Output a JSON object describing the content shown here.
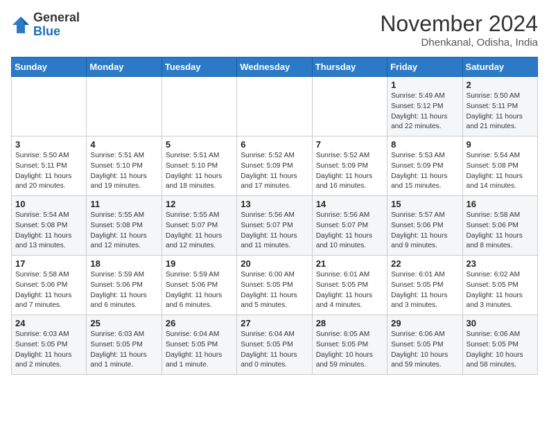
{
  "logo": {
    "general": "General",
    "blue": "Blue"
  },
  "header": {
    "month": "November 2024",
    "location": "Dhenkanal, Odisha, India"
  },
  "weekdays": [
    "Sunday",
    "Monday",
    "Tuesday",
    "Wednesday",
    "Thursday",
    "Friday",
    "Saturday"
  ],
  "weeks": [
    [
      {
        "day": "",
        "info": ""
      },
      {
        "day": "",
        "info": ""
      },
      {
        "day": "",
        "info": ""
      },
      {
        "day": "",
        "info": ""
      },
      {
        "day": "",
        "info": ""
      },
      {
        "day": "1",
        "info": "Sunrise: 5:49 AM\nSunset: 5:12 PM\nDaylight: 11 hours\nand 22 minutes."
      },
      {
        "day": "2",
        "info": "Sunrise: 5:50 AM\nSunset: 5:11 PM\nDaylight: 11 hours\nand 21 minutes."
      }
    ],
    [
      {
        "day": "3",
        "info": "Sunrise: 5:50 AM\nSunset: 5:11 PM\nDaylight: 11 hours\nand 20 minutes."
      },
      {
        "day": "4",
        "info": "Sunrise: 5:51 AM\nSunset: 5:10 PM\nDaylight: 11 hours\nand 19 minutes."
      },
      {
        "day": "5",
        "info": "Sunrise: 5:51 AM\nSunset: 5:10 PM\nDaylight: 11 hours\nand 18 minutes."
      },
      {
        "day": "6",
        "info": "Sunrise: 5:52 AM\nSunset: 5:09 PM\nDaylight: 11 hours\nand 17 minutes."
      },
      {
        "day": "7",
        "info": "Sunrise: 5:52 AM\nSunset: 5:09 PM\nDaylight: 11 hours\nand 16 minutes."
      },
      {
        "day": "8",
        "info": "Sunrise: 5:53 AM\nSunset: 5:09 PM\nDaylight: 11 hours\nand 15 minutes."
      },
      {
        "day": "9",
        "info": "Sunrise: 5:54 AM\nSunset: 5:08 PM\nDaylight: 11 hours\nand 14 minutes."
      }
    ],
    [
      {
        "day": "10",
        "info": "Sunrise: 5:54 AM\nSunset: 5:08 PM\nDaylight: 11 hours\nand 13 minutes."
      },
      {
        "day": "11",
        "info": "Sunrise: 5:55 AM\nSunset: 5:08 PM\nDaylight: 11 hours\nand 12 minutes."
      },
      {
        "day": "12",
        "info": "Sunrise: 5:55 AM\nSunset: 5:07 PM\nDaylight: 11 hours\nand 12 minutes."
      },
      {
        "day": "13",
        "info": "Sunrise: 5:56 AM\nSunset: 5:07 PM\nDaylight: 11 hours\nand 11 minutes."
      },
      {
        "day": "14",
        "info": "Sunrise: 5:56 AM\nSunset: 5:07 PM\nDaylight: 11 hours\nand 10 minutes."
      },
      {
        "day": "15",
        "info": "Sunrise: 5:57 AM\nSunset: 5:06 PM\nDaylight: 11 hours\nand 9 minutes."
      },
      {
        "day": "16",
        "info": "Sunrise: 5:58 AM\nSunset: 5:06 PM\nDaylight: 11 hours\nand 8 minutes."
      }
    ],
    [
      {
        "day": "17",
        "info": "Sunrise: 5:58 AM\nSunset: 5:06 PM\nDaylight: 11 hours\nand 7 minutes."
      },
      {
        "day": "18",
        "info": "Sunrise: 5:59 AM\nSunset: 5:06 PM\nDaylight: 11 hours\nand 6 minutes."
      },
      {
        "day": "19",
        "info": "Sunrise: 5:59 AM\nSunset: 5:06 PM\nDaylight: 11 hours\nand 6 minutes."
      },
      {
        "day": "20",
        "info": "Sunrise: 6:00 AM\nSunset: 5:05 PM\nDaylight: 11 hours\nand 5 minutes."
      },
      {
        "day": "21",
        "info": "Sunrise: 6:01 AM\nSunset: 5:05 PM\nDaylight: 11 hours\nand 4 minutes."
      },
      {
        "day": "22",
        "info": "Sunrise: 6:01 AM\nSunset: 5:05 PM\nDaylight: 11 hours\nand 3 minutes."
      },
      {
        "day": "23",
        "info": "Sunrise: 6:02 AM\nSunset: 5:05 PM\nDaylight: 11 hours\nand 3 minutes."
      }
    ],
    [
      {
        "day": "24",
        "info": "Sunrise: 6:03 AM\nSunset: 5:05 PM\nDaylight: 11 hours\nand 2 minutes."
      },
      {
        "day": "25",
        "info": "Sunrise: 6:03 AM\nSunset: 5:05 PM\nDaylight: 11 hours\nand 1 minute."
      },
      {
        "day": "26",
        "info": "Sunrise: 6:04 AM\nSunset: 5:05 PM\nDaylight: 11 hours\nand 1 minute."
      },
      {
        "day": "27",
        "info": "Sunrise: 6:04 AM\nSunset: 5:05 PM\nDaylight: 11 hours\nand 0 minutes."
      },
      {
        "day": "28",
        "info": "Sunrise: 6:05 AM\nSunset: 5:05 PM\nDaylight: 10 hours\nand 59 minutes."
      },
      {
        "day": "29",
        "info": "Sunrise: 6:06 AM\nSunset: 5:05 PM\nDaylight: 10 hours\nand 59 minutes."
      },
      {
        "day": "30",
        "info": "Sunrise: 6:06 AM\nSunset: 5:05 PM\nDaylight: 10 hours\nand 58 minutes."
      }
    ]
  ]
}
